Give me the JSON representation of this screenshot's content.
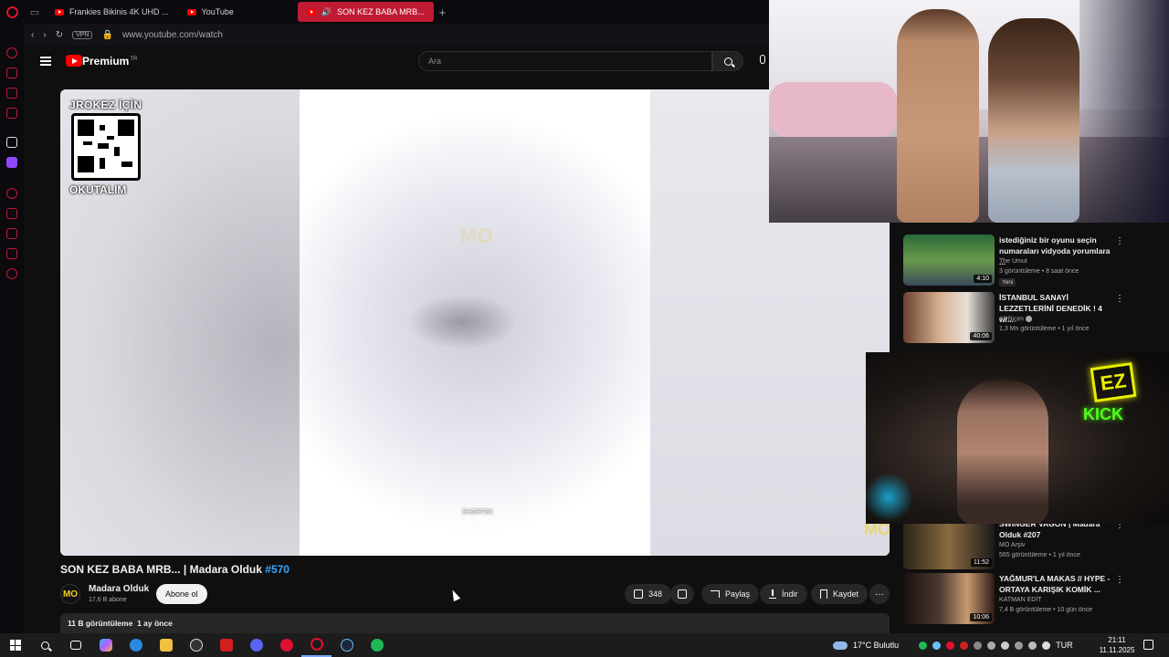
{
  "browser": {
    "tabs": [
      {
        "label": "Frankies Bikinis 4K UHD ..."
      },
      {
        "label": "YouTube"
      },
      {
        "label": "SON KEZ BABA MRB..."
      }
    ],
    "new_tab": "+",
    "vpn_label": "VPN",
    "url": "www.youtube.com/watch"
  },
  "youtube": {
    "brand": "Premium",
    "brand_sup": "TR",
    "search_placeholder": "Ara",
    "player": {
      "qr_top": "JROKEZ İÇİN",
      "qr_bottom": "OKUTALIM",
      "watermark": "MO",
      "shorts_tag": "SHORTSK",
      "corner_logo": "MO"
    },
    "video": {
      "title": "SON KEZ BABA MRB... | Madara Olduk",
      "hashtag": "#570",
      "channel": "Madara Olduk",
      "channel_avatar": "MO",
      "subscribers": "17,6 B abone",
      "subscribe_label": "Abone ol",
      "likes": "348",
      "share_label": "Paylaş",
      "download_label": "İndir",
      "save_label": "Kaydet",
      "more_label": "···",
      "views": "11 B görüntüleme",
      "age": "1 ay önce"
    },
    "recommendations": [
      {
        "title": "istediğiniz bir oyunu seçin numaraları vidyoda yorumlara ...",
        "channel": "The Umut",
        "meta": "3 görüntüleme • 8 saat önce",
        "duration": "4:10",
        "badge": "Yeni"
      },
      {
        "title": "İSTANBUL SANAYİ LEZZETLERİNİ DENEDİK ! 4 w/...",
        "channel": "Ali Biçim",
        "meta": "1,3 Mn görüntüleme • 1 yıl önce",
        "duration": "40:06",
        "badge": ""
      },
      {
        "title": "SWINGER VAGON | Madara Olduk #207",
        "channel": "MO Arşiv",
        "meta": "565 görüntüleme • 1 yıl önce",
        "duration": "11:52",
        "badge": ""
      },
      {
        "title": "YAĞMUR'LA MAKAS // HYPE - ORTAYA KARIŞIK KOMİK ...",
        "channel": "KATMAN EDİT",
        "meta": "7,4 B görüntüleme • 10 gün önce",
        "duration": "10:06",
        "badge": ""
      }
    ]
  },
  "overlays": {
    "ez_sign": "EZ",
    "kick_sign": "KICK"
  },
  "taskbar": {
    "weather": "17°C  Bulutlu",
    "lang": "TUR",
    "time": "21:11",
    "date": "11.11.2025"
  },
  "colors": {
    "opera_red": "#c11a33",
    "youtube_red": "#ff0000",
    "link_blue": "#3ea6ff",
    "kick_green": "#53fc18"
  }
}
